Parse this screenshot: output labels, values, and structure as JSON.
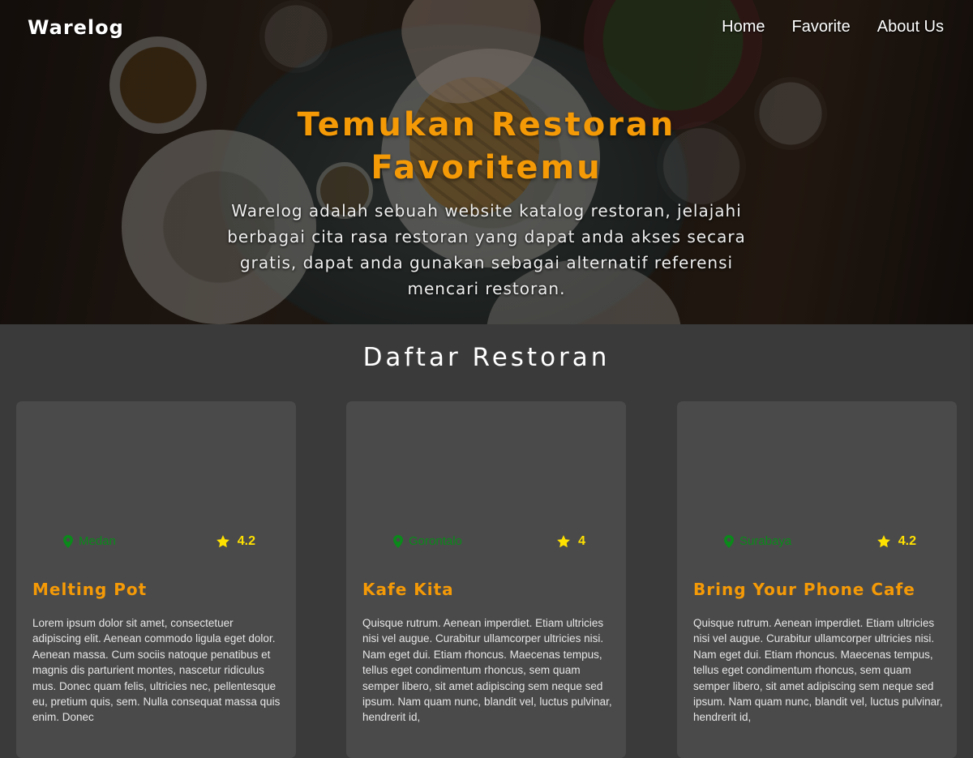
{
  "nav": {
    "brand": "Warelog",
    "links": [
      "Home",
      "Favorite",
      "About Us"
    ]
  },
  "hero": {
    "title": "Temukan Restoran Favoritemu",
    "description": "Warelog adalah sebuah website katalog restoran, jelajahi berbagai cita rasa restoran yang dapat anda akses secara gratis, dapat anda gunakan sebagai alternatif referensi mencari restoran."
  },
  "section": {
    "title": "Daftar Restoran"
  },
  "restaurants": [
    {
      "name": "Melting Pot",
      "city": "Medan",
      "rating": "4.2",
      "description": "Lorem ipsum dolor sit amet, consectetuer adipiscing elit. Aenean commodo ligula eget dolor. Aenean massa. Cum sociis natoque penatibus et magnis dis parturient montes, nascetur ridiculus mus. Donec quam felis, ultricies nec, pellentesque eu, pretium quis, sem. Nulla consequat massa quis enim. Donec"
    },
    {
      "name": "Kafe Kita",
      "city": "Gorontalo",
      "rating": "4",
      "description": "Quisque rutrum. Aenean imperdiet. Etiam ultricies nisi vel augue. Curabitur ullamcorper ultricies nisi. Nam eget dui. Etiam rhoncus. Maecenas tempus, tellus eget condimentum rhoncus, sem quam semper libero, sit amet adipiscing sem neque sed ipsum. Nam quam nunc, blandit vel, luctus pulvinar, hendrerit id,"
    },
    {
      "name": "Bring Your Phone Cafe",
      "city": "Surabaya",
      "rating": "4.2",
      "description": "Quisque rutrum. Aenean imperdiet. Etiam ultricies nisi vel augue. Curabitur ullamcorper ultricies nisi. Nam eget dui. Etiam rhoncus. Maecenas tempus, tellus eget condimentum rhoncus, sem quam semper libero, sit amet adipiscing sem neque sed ipsum. Nam quam nunc, blandit vel, luctus pulvinar, hendrerit id,"
    }
  ],
  "colors": {
    "accent": "#f59a07",
    "location": "#0a8a1a",
    "rating": "#ffe100",
    "card": "#4a4a4a",
    "background": "#3a3a3a"
  },
  "icons": {
    "location": "map-pin-icon",
    "rating": "star-icon"
  }
}
